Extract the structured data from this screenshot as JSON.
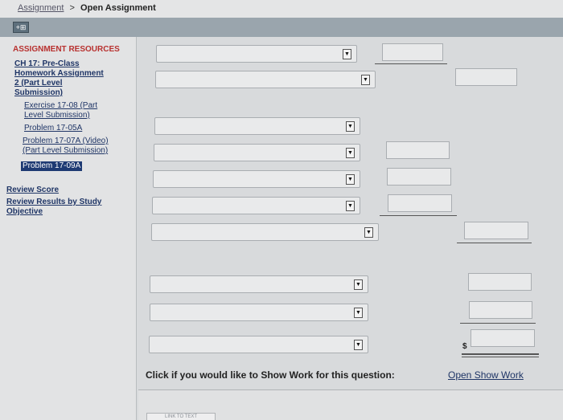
{
  "breadcrumb": {
    "parent": "Assignment",
    "separator": ">",
    "current": "Open Assignment"
  },
  "toolbar": {
    "expand_glyph": "+⊞"
  },
  "sidebar": {
    "heading": "ASSIGNMENT RESOURCES",
    "assignment_line1": "CH 17: Pre-Class",
    "assignment_line2": "Homework Assignment",
    "assignment_line3": "2 (Part Level",
    "assignment_line4": "Submission)",
    "items": [
      {
        "line1": "Exercise 17-08 (Part",
        "line2": "Level Submission)"
      },
      {
        "line1": "Problem 17-05A",
        "line2": ""
      },
      {
        "line1": "Problem 17-07A (Video)",
        "line2": "(Part Level Submission)"
      },
      {
        "line1": "Problem 17-09A",
        "line2": ""
      }
    ],
    "review_score": "Review Score",
    "review_results_line1": "Review Results by Study",
    "review_results_line2": "Objective"
  },
  "form": {
    "dropdown_arrow": "▼",
    "currency_symbol": "$"
  },
  "show_work": {
    "prompt": "Click if you would like to Show Work for this question:",
    "link": "Open Show Work"
  },
  "bottom": {
    "tab_label": "LINK TO TEXT"
  }
}
